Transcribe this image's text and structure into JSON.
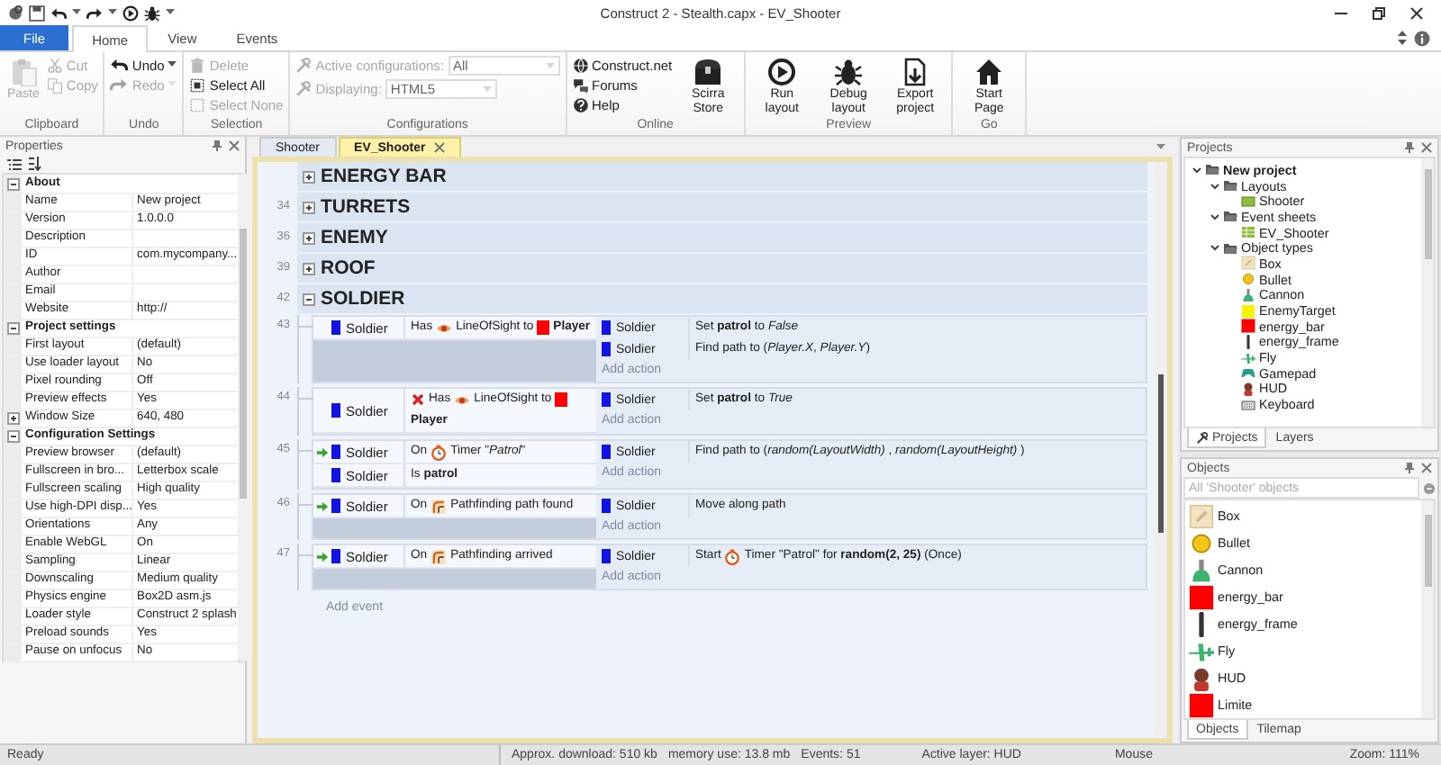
{
  "window": {
    "title": "Construct 2 - Stealth.capx - EV_Shooter"
  },
  "ribbon": {
    "tabs": [
      {
        "label": "File",
        "kind": "file",
        "selected": false
      },
      {
        "label": "Home",
        "kind": "tab",
        "selected": true
      },
      {
        "label": "View",
        "kind": "tab",
        "selected": false
      },
      {
        "label": "Events",
        "kind": "tab",
        "selected": false
      }
    ],
    "groups": [
      {
        "label": "Clipboard",
        "columns": [
          [
            {
              "kind": "large",
              "label": "Paste",
              "disabled": true
            }
          ],
          [
            {
              "kind": "small",
              "label": "Cut",
              "disabled": true
            },
            {
              "kind": "small",
              "label": "Copy",
              "disabled": true
            }
          ]
        ]
      },
      {
        "label": "Undo",
        "columns": [
          [
            {
              "kind": "split",
              "label": "Undo",
              "disabled": false
            },
            {
              "kind": "split",
              "label": "Redo",
              "disabled": true
            }
          ]
        ]
      },
      {
        "label": "Selection",
        "columns": [
          [
            {
              "kind": "small",
              "label": "Delete",
              "disabled": true
            },
            {
              "kind": "small",
              "label": "Select All",
              "disabled": false
            },
            {
              "kind": "small",
              "label": "Select None",
              "disabled": true
            }
          ]
        ]
      },
      {
        "label": "Configurations",
        "columns": [
          [
            {
              "kind": "dropdown",
              "label": "Active configurations:",
              "value": "All",
              "disabled": true
            },
            {
              "kind": "dropdown",
              "label": "Displaying:",
              "value": "HTML5",
              "disabled": true
            }
          ]
        ]
      },
      {
        "label": "Online",
        "columns": [
          [
            {
              "kind": "small",
              "label": "Construct.net",
              "disabled": false
            },
            {
              "kind": "small",
              "label": "Forums",
              "disabled": false
            },
            {
              "kind": "small",
              "label": "Help",
              "disabled": false
            }
          ],
          [
            {
              "kind": "large",
              "label": "Scirra Store",
              "disabled": false
            }
          ]
        ]
      },
      {
        "label": "Preview",
        "columns": [
          [
            {
              "kind": "large",
              "label": "Run layout",
              "disabled": false
            }
          ],
          [
            {
              "kind": "large",
              "label": "Debug layout",
              "disabled": false
            }
          ],
          [
            {
              "kind": "large",
              "label": "Export project",
              "disabled": false
            }
          ]
        ]
      },
      {
        "label": "Go",
        "columns": [
          [
            {
              "kind": "large",
              "label": "Start Page",
              "disabled": false
            }
          ]
        ]
      }
    ]
  },
  "properties": {
    "title": "Properties",
    "sections": [
      {
        "label": "About",
        "expanded": true,
        "rows": [
          {
            "name": "Name",
            "value": "New project"
          },
          {
            "name": "Version",
            "value": "1.0.0.0"
          },
          {
            "name": "Description"
          },
          {
            "name": "ID",
            "value": "com.mycompany..."
          },
          {
            "name": "Author"
          },
          {
            "name": "Email"
          },
          {
            "name": "Website",
            "value": "http://"
          }
        ]
      },
      {
        "label": "Project settings",
        "expanded": true,
        "rows": [
          {
            "name": "First layout",
            "value": "(default)"
          },
          {
            "name": "Use loader layout",
            "value": "No"
          },
          {
            "name": "Pixel rounding",
            "value": "Off"
          },
          {
            "name": "Preview effects",
            "value": "Yes"
          },
          {
            "name": "Window Size",
            "value": "640, 480",
            "expanded": false
          }
        ]
      },
      {
        "label": "Configuration Settings",
        "expanded": true,
        "rows": [
          {
            "name": "Preview browser",
            "value": "(default)"
          },
          {
            "name": "Fullscreen in bro...",
            "value": "Letterbox scale"
          },
          {
            "name": "Fullscreen scaling",
            "value": "High quality"
          },
          {
            "name": "Use high-DPI disp...",
            "value": "Yes"
          },
          {
            "name": "Orientations",
            "value": "Any"
          },
          {
            "name": "Enable WebGL",
            "value": "On"
          },
          {
            "name": "Sampling",
            "value": "Linear"
          },
          {
            "name": "Downscaling",
            "value": "Medium quality"
          },
          {
            "name": "Physics engine",
            "value": "Box2D asm.js"
          },
          {
            "name": "Loader style",
            "value": "Construct 2 splash"
          },
          {
            "name": "Preload sounds",
            "value": "Yes"
          },
          {
            "name": "Pause on unfocus",
            "value": "No"
          }
        ]
      }
    ]
  },
  "editor": {
    "tabs": [
      {
        "label": "Shooter",
        "selected": false
      },
      {
        "label": "EV_Shooter",
        "selected": true
      }
    ],
    "groups": [
      {
        "title": "ENERGY BAR",
        "expanded": false
      },
      {
        "line": "34",
        "title": "TURRETS",
        "expanded": false
      },
      {
        "line": "36",
        "title": "ENEMY",
        "expanded": false
      },
      {
        "line": "39",
        "title": "ROOF",
        "expanded": false
      },
      {
        "line": "42",
        "title": "SOLDIER",
        "expanded": true
      }
    ],
    "events": [
      {
        "line": "43",
        "trigger": false,
        "conditions": [
          {
            "object": "Soldier",
            "inverted": false,
            "prefix": "Has",
            "text": "LineOfSight to",
            "target": "Player"
          }
        ],
        "actions": [
          {
            "object": "Soldier",
            "text": "Set **patrol** to *False*"
          },
          {
            "object": "Soldier",
            "text": "Find path to (*Player.X*, *Player.Y*)"
          }
        ],
        "add_action": "Add action"
      },
      {
        "line": "44",
        "trigger": false,
        "conditions": [
          {
            "object": "Soldier",
            "inverted": true,
            "prefix": "Has",
            "text": "LineOfSight to",
            "target": "Player"
          }
        ],
        "actions": [
          {
            "object": "Soldier",
            "text": "Set **patrol** to *True*"
          }
        ],
        "add_action": "Add action"
      },
      {
        "line": "45",
        "trigger": true,
        "conditions": [
          {
            "object": "Soldier",
            "inverted": false,
            "prefix": "On",
            "text": "Timer \"*Patrol*\""
          },
          {
            "object": "Soldier",
            "inverted": false,
            "text": "Is **patrol**"
          }
        ],
        "actions": [
          {
            "object": "Soldier",
            "text": "Find path to (*random(LayoutWidth)* , *random(LayoutHeight)* )"
          }
        ],
        "add_action": "Add action"
      },
      {
        "line": "46",
        "trigger": true,
        "conditions": [
          {
            "object": "Soldier",
            "inverted": false,
            "prefix": "On",
            "text": "Pathfinding path found"
          }
        ],
        "actions": [
          {
            "object": "Soldier",
            "text": "Move along path"
          }
        ],
        "add_action": "Add action"
      },
      {
        "line": "47",
        "trigger": true,
        "conditions": [
          {
            "object": "Soldier",
            "inverted": false,
            "prefix": "On",
            "text": "Pathfinding arrived"
          }
        ],
        "actions": [
          {
            "object": "Soldier",
            "prefix": "Start",
            "text": "Timer \"Patrol\" for **random(2, 25)** (Once)"
          }
        ],
        "add_action": "Add action"
      }
    ],
    "add_event": "Add event"
  },
  "projects": {
    "title": "Projects",
    "tree": [
      {
        "label": "New project",
        "expanded": true,
        "children": [
          {
            "label": "Layouts",
            "expanded": true,
            "children": [
              {
                "label": "Shooter"
              }
            ]
          },
          {
            "label": "Event sheets",
            "expanded": true,
            "children": [
              {
                "label": "EV_Shooter"
              }
            ]
          },
          {
            "label": "Object types",
            "expanded": true,
            "children": [
              {
                "label": "Box"
              },
              {
                "label": "Bullet"
              },
              {
                "label": "Cannon"
              },
              {
                "label": "EnemyTarget"
              },
              {
                "label": "energy_bar"
              },
              {
                "label": "energy_frame"
              },
              {
                "label": "Fly"
              },
              {
                "label": "Gamepad"
              },
              {
                "label": "HUD"
              },
              {
                "label": "Keyboard"
              }
            ]
          }
        ]
      }
    ],
    "tabs": [
      {
        "label": "Projects",
        "selected": true
      },
      {
        "label": "Layers",
        "selected": false
      }
    ]
  },
  "objects": {
    "title": "Objects",
    "search": {
      "placeholder": "All 'Shooter' objects"
    },
    "items": [
      {
        "label": "Box"
      },
      {
        "label": "Bullet"
      },
      {
        "label": "Cannon"
      },
      {
        "label": "energy_bar"
      },
      {
        "label": "energy_frame"
      },
      {
        "label": "Fly"
      },
      {
        "label": "HUD"
      },
      {
        "label": "Limite"
      }
    ],
    "tabs": [
      {
        "label": "Objects",
        "selected": true
      },
      {
        "label": "Tilemap",
        "selected": false
      }
    ]
  },
  "status_bar": {
    "message": "Ready",
    "fields": [
      "Approx. download: 510 kb",
      "memory use: 13.8 mb",
      "Events: 51",
      "Active layer: HUD",
      "Mouse",
      "Zoom: 111%"
    ]
  }
}
